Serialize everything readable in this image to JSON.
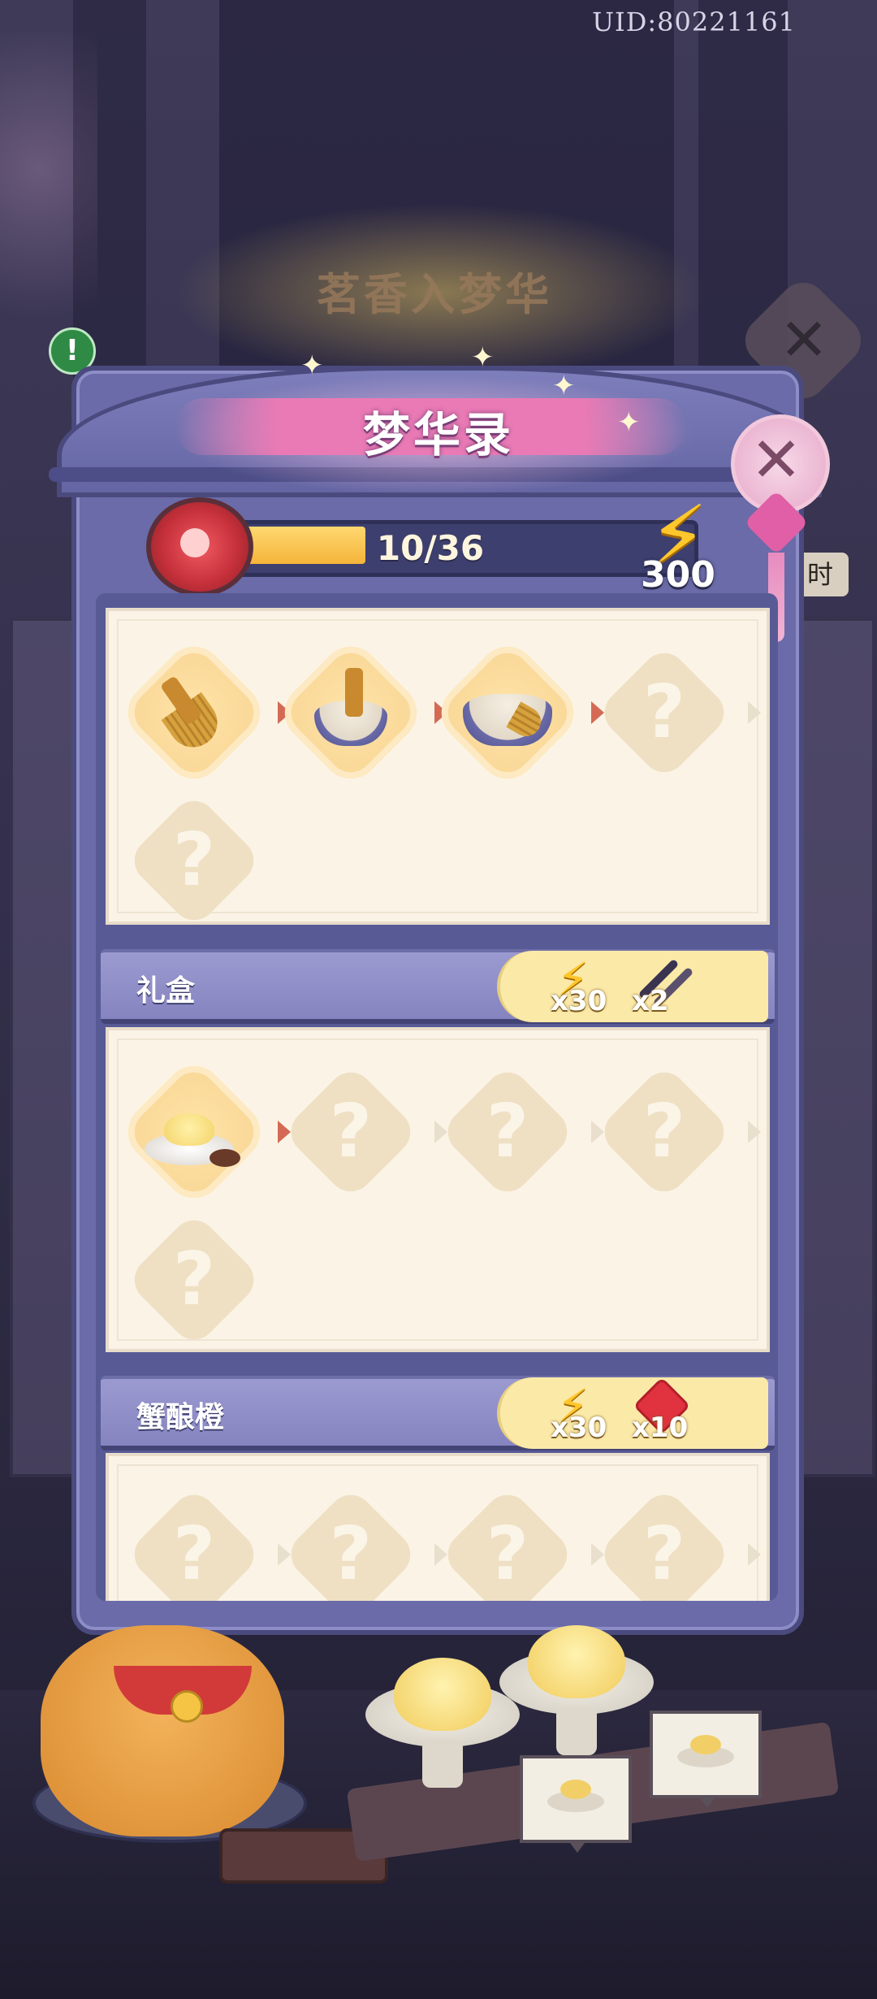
{
  "header": {
    "uid": "UID:80221161"
  },
  "background": {
    "title": "茗香入梦华",
    "time_tag": "时"
  },
  "panel": {
    "title": "梦华录",
    "progress": {
      "label": "10/36",
      "current": 10,
      "total": 36
    },
    "energy": {
      "value": "300",
      "icon": "lightning-icon"
    },
    "colors": {
      "accent": "#ffc72c",
      "panel": "#6a6ba8",
      "card": "#fbf4e6",
      "reward_tab": "#fbe9a8"
    }
  },
  "sections": [
    {
      "name": "",
      "nodes": [
        {
          "state": "unlocked",
          "icon": "whisk-icon"
        },
        {
          "state": "unlocked",
          "icon": "tea-bowl-whisk-icon"
        },
        {
          "state": "unlocked",
          "icon": "matcha-bowl-icon"
        },
        {
          "state": "locked",
          "label": "?"
        },
        {
          "state": "locked",
          "label": "?"
        }
      ]
    },
    {
      "name": "礼盒",
      "rewards": [
        {
          "icon": "lightning-icon",
          "qty": "x30"
        },
        {
          "icon": "chopsticks-icon",
          "qty": "x2"
        }
      ],
      "nodes": [
        {
          "state": "unlocked",
          "icon": "steamed-bun-plate-icon"
        },
        {
          "state": "locked",
          "label": "?"
        },
        {
          "state": "locked",
          "label": "?"
        },
        {
          "state": "locked",
          "label": "?"
        },
        {
          "state": "locked",
          "label": "?"
        }
      ]
    },
    {
      "name": "蟹酿橙",
      "rewards": [
        {
          "icon": "lightning-icon",
          "qty": "x30"
        },
        {
          "icon": "ruby-gem-icon",
          "qty": "x10"
        }
      ],
      "nodes": [
        {
          "state": "locked",
          "label": "?"
        },
        {
          "state": "locked",
          "label": "?"
        },
        {
          "state": "locked",
          "label": "?"
        },
        {
          "state": "locked",
          "label": "?"
        }
      ]
    }
  ]
}
